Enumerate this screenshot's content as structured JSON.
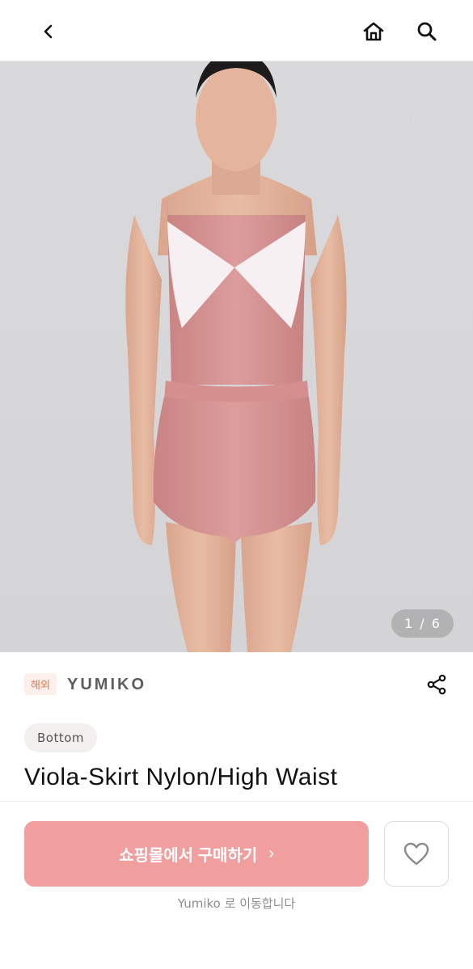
{
  "header": {
    "back_icon": "chevron-left-icon",
    "home_icon": "home-icon",
    "search_icon": "search-icon"
  },
  "gallery": {
    "current": "1",
    "separator": "/",
    "total": "6"
  },
  "brand": {
    "badge": "해외",
    "name": "YUMIKO",
    "share_icon": "share-icon"
  },
  "product": {
    "category": "Bottom",
    "title": "Viola-Skirt Nylon/High Waist"
  },
  "actions": {
    "buy_label": "쇼핑몰에서 구매하기",
    "buy_chevron": "›",
    "wishlist_icon": "heart-icon",
    "redirect_note": "Yumiko 로 이동합니다"
  },
  "colors": {
    "accent": "#f19e9f",
    "badge_text": "#e8744a",
    "badge_bg": "#fdf0ea"
  }
}
